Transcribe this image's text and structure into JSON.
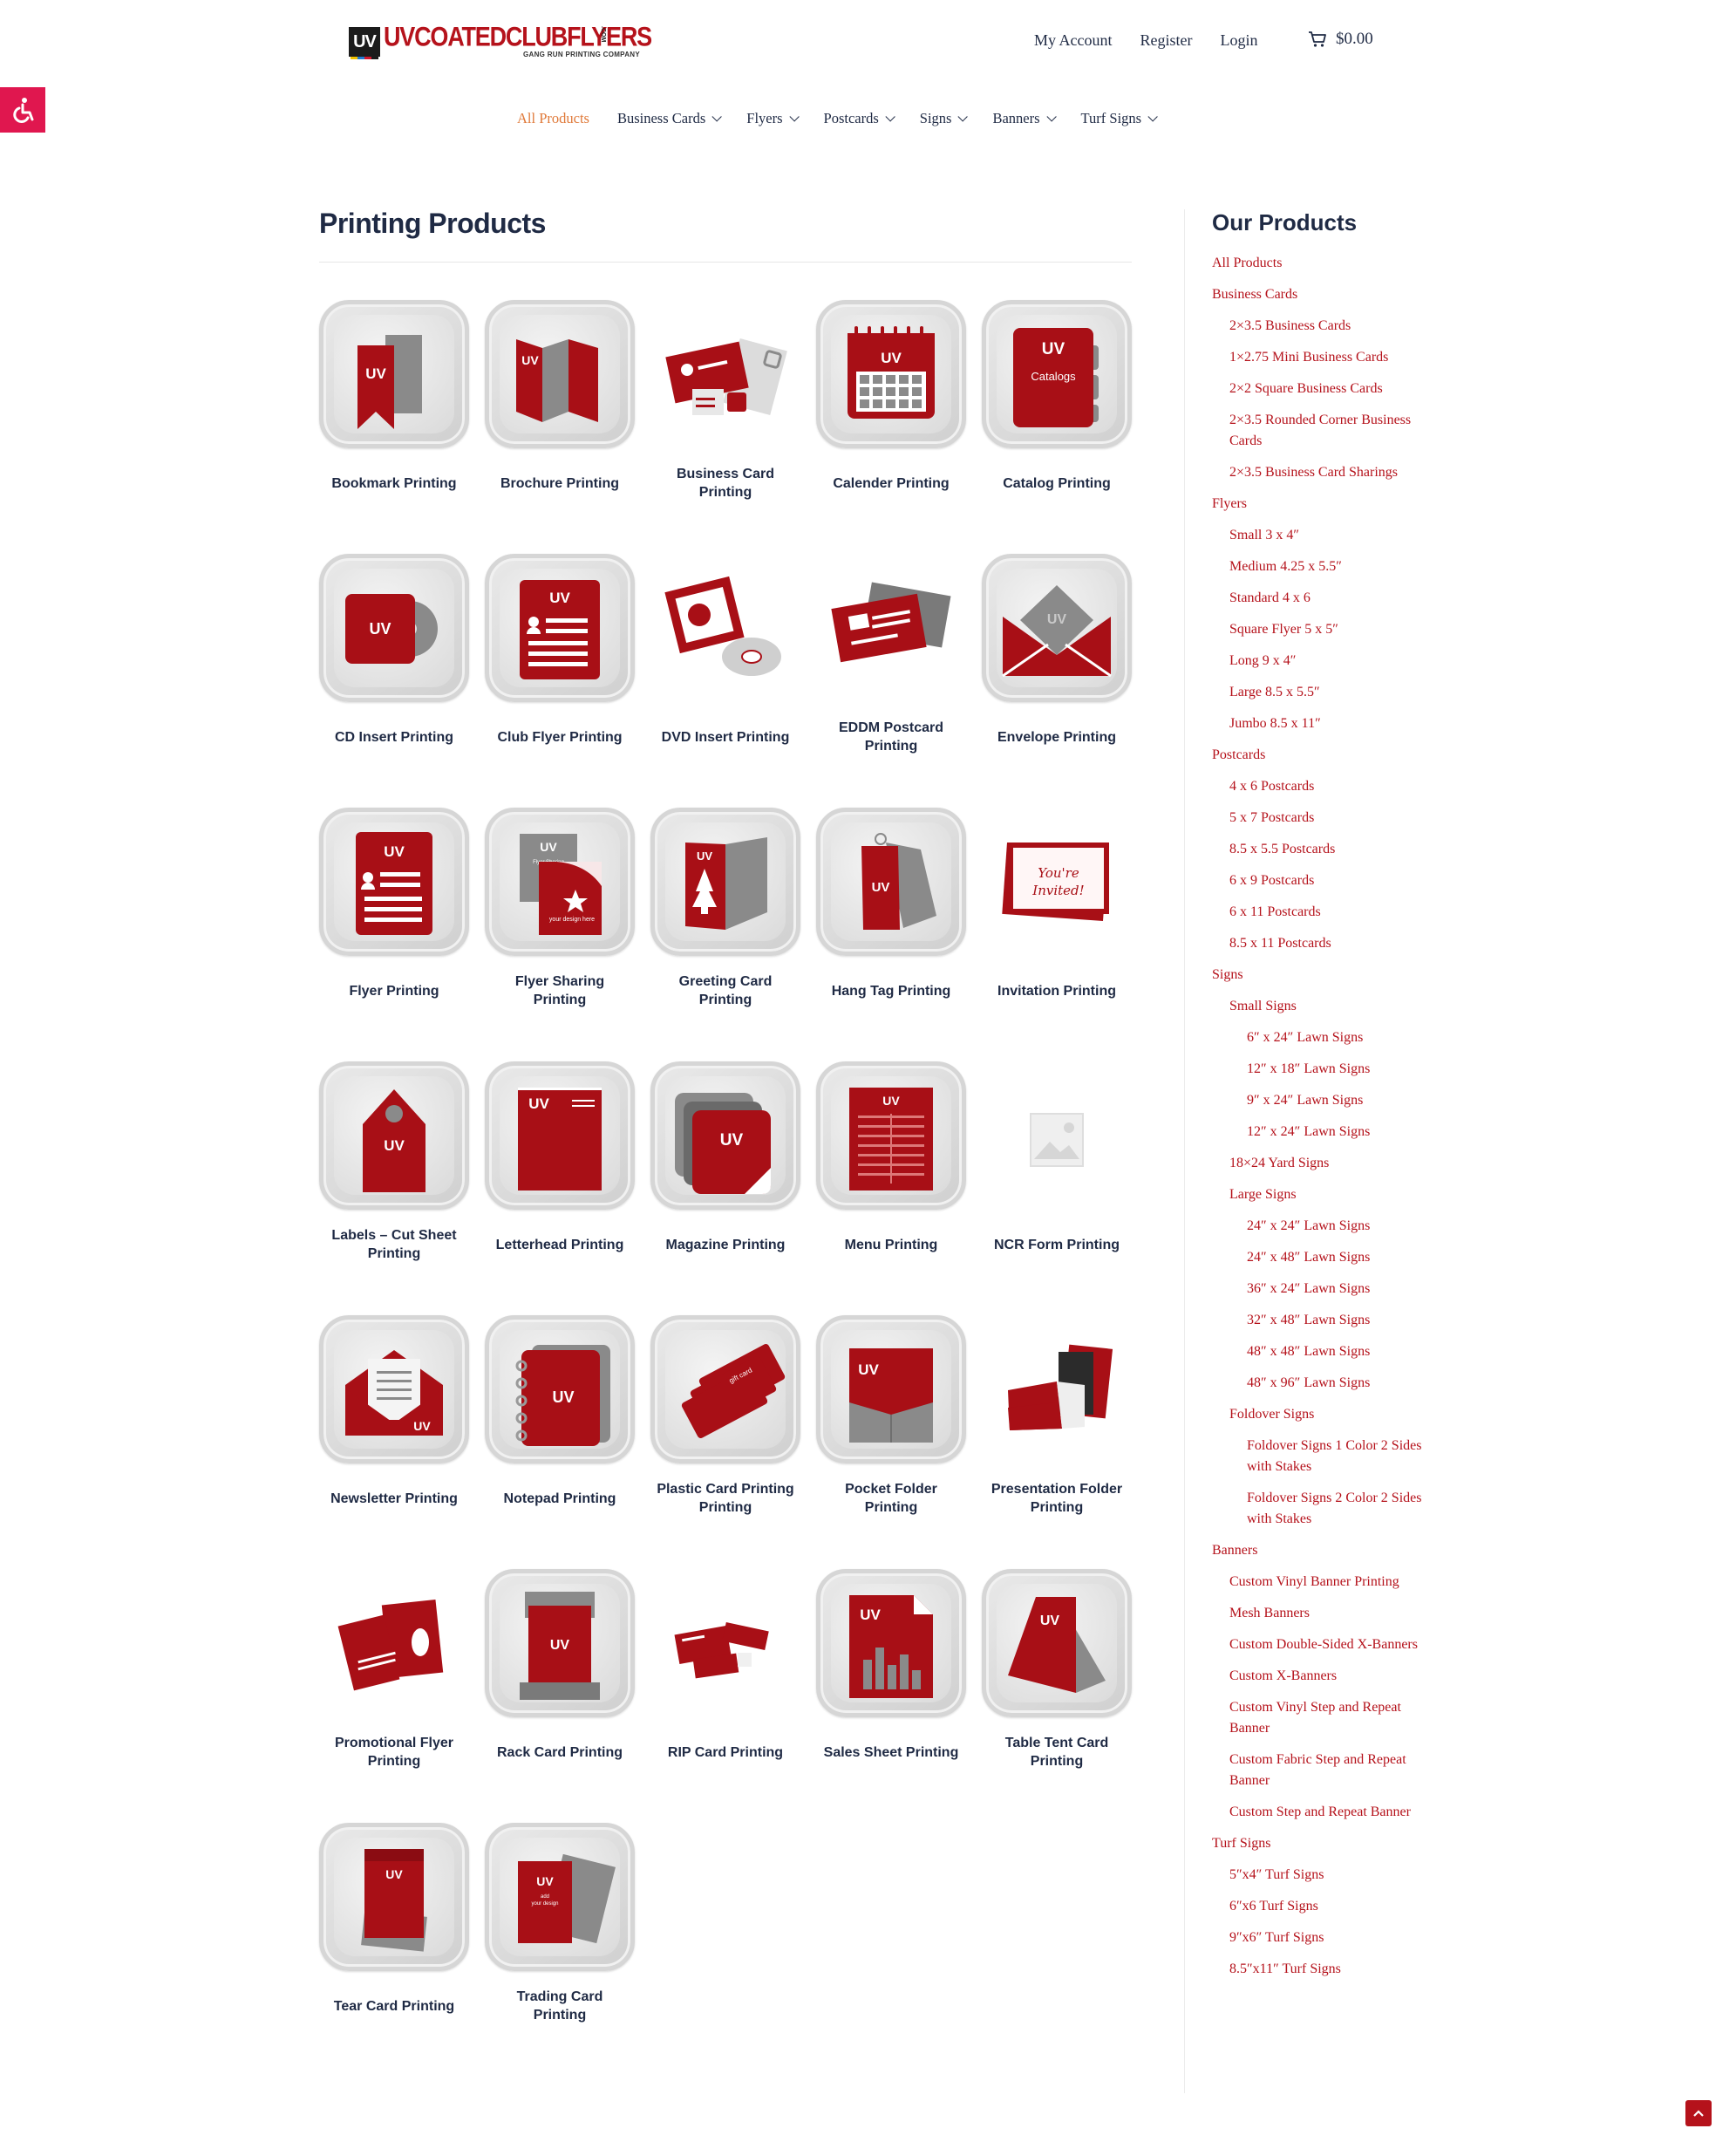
{
  "header": {
    "logo": {
      "mark": "UV",
      "name": "UVCOATEDCLUBFLYERS",
      "suffix": ".COM",
      "tagline": "GANG RUN PRINTING COMPANY"
    },
    "account_links": [
      "My Account",
      "Register",
      "Login"
    ],
    "cart_total": "$0.00"
  },
  "nav": [
    {
      "label": "All Products",
      "active": true,
      "dropdown": false
    },
    {
      "label": "Business Cards",
      "dropdown": true
    },
    {
      "label": "Flyers",
      "dropdown": true
    },
    {
      "label": "Postcards",
      "dropdown": true
    },
    {
      "label": "Signs",
      "dropdown": true
    },
    {
      "label": "Banners",
      "dropdown": true
    },
    {
      "label": "Turf Signs",
      "dropdown": true
    }
  ],
  "main": {
    "title": "Printing Products",
    "products": [
      {
        "label": "Bookmark Printing",
        "icon": "bookmark-icon",
        "tile": true
      },
      {
        "label": "Brochure Printing",
        "icon": "brochure-icon",
        "tile": true
      },
      {
        "label": "Business Card Printing",
        "icon": "business-card-icon",
        "tile": false
      },
      {
        "label": "Calender Printing",
        "icon": "calendar-icon",
        "tile": true
      },
      {
        "label": "Catalog Printing",
        "icon": "catalog-icon",
        "tile": true,
        "text": "Catalogs"
      },
      {
        "label": "CD Insert Printing",
        "icon": "cd-insert-icon",
        "tile": true
      },
      {
        "label": "Club Flyer Printing",
        "icon": "club-flyer-icon",
        "tile": true
      },
      {
        "label": "DVD Insert Printing",
        "icon": "dvd-insert-icon",
        "tile": false
      },
      {
        "label": "EDDM Postcard Printing",
        "icon": "eddm-postcard-icon",
        "tile": false
      },
      {
        "label": "Envelope Printing",
        "icon": "envelope-icon",
        "tile": true
      },
      {
        "label": "Flyer Printing",
        "icon": "flyer-icon",
        "tile": true
      },
      {
        "label": "Flyer Sharing Printing",
        "icon": "flyer-sharing-icon",
        "tile": true,
        "text": "Flyer Sharing",
        "text2": "your design here"
      },
      {
        "label": "Greeting Card Printing",
        "icon": "greeting-card-icon",
        "tile": true
      },
      {
        "label": "Hang Tag Printing",
        "icon": "hang-tag-icon",
        "tile": true
      },
      {
        "label": "Invitation Printing",
        "icon": "invitation-icon",
        "tile": false,
        "text": "You're Invited!"
      },
      {
        "label": "Labels – Cut Sheet Printing",
        "icon": "label-tag-icon",
        "tile": true
      },
      {
        "label": "Letterhead Printing",
        "icon": "letterhead-icon",
        "tile": true
      },
      {
        "label": "Magazine Printing",
        "icon": "magazine-icon",
        "tile": true
      },
      {
        "label": "Menu Printing",
        "icon": "menu-icon",
        "tile": true
      },
      {
        "label": "NCR Form Printing",
        "icon": "image-placeholder-icon",
        "tile": false
      },
      {
        "label": "Newsletter Printing",
        "icon": "newsletter-icon",
        "tile": true
      },
      {
        "label": "Notepad Printing",
        "icon": "notepad-icon",
        "tile": true
      },
      {
        "label": "Plastic Card Printing Printing",
        "icon": "plastic-card-icon",
        "tile": true
      },
      {
        "label": "Pocket Folder Printing",
        "icon": "pocket-folder-icon",
        "tile": true
      },
      {
        "label": "Presentation Folder Printing",
        "icon": "presentation-folder-icon",
        "tile": false
      },
      {
        "label": "Promotional Flyer Printing",
        "icon": "promotional-flyer-icon",
        "tile": false
      },
      {
        "label": "Rack Card Printing",
        "icon": "rack-card-icon",
        "tile": true
      },
      {
        "label": "RIP Card Printing",
        "icon": "rip-card-icon",
        "tile": false
      },
      {
        "label": "Sales Sheet Printing",
        "icon": "sales-sheet-icon",
        "tile": true
      },
      {
        "label": "Table Tent Card Printing",
        "icon": "table-tent-icon",
        "tile": true
      },
      {
        "label": "Tear Card Printing",
        "icon": "tear-card-icon",
        "tile": true
      },
      {
        "label": "Trading Card Printing",
        "icon": "trading-card-icon",
        "tile": true,
        "text": "add your design"
      }
    ]
  },
  "sidebar": {
    "title": "Our Products",
    "items": [
      {
        "label": "All Products",
        "level": 0
      },
      {
        "label": "Business Cards",
        "level": 0
      },
      {
        "label": "2×3.5 Business Cards",
        "level": 1
      },
      {
        "label": "1×2.75 Mini Business Cards",
        "level": 1
      },
      {
        "label": "2×2 Square Business Cards",
        "level": 1
      },
      {
        "label": "2×3.5 Rounded Corner Business Cards",
        "level": 1
      },
      {
        "label": "2×3.5 Business Card Sharings",
        "level": 1
      },
      {
        "label": "Flyers",
        "level": 0
      },
      {
        "label": "Small 3 x 4″",
        "level": 1
      },
      {
        "label": "Medium 4.25 x 5.5″",
        "level": 1
      },
      {
        "label": "Standard 4 x 6",
        "level": 1
      },
      {
        "label": "Square Flyer 5 x 5″",
        "level": 1
      },
      {
        "label": "Long 9 x 4″",
        "level": 1
      },
      {
        "label": "Large 8.5 x 5.5″",
        "level": 1
      },
      {
        "label": "Jumbo 8.5 x 11″",
        "level": 1
      },
      {
        "label": "Postcards",
        "level": 0
      },
      {
        "label": "4 x 6 Postcards",
        "level": 1
      },
      {
        "label": "5 x 7 Postcards",
        "level": 1
      },
      {
        "label": "8.5 x 5.5 Postcards",
        "level": 1
      },
      {
        "label": "6 x 9 Postcards",
        "level": 1
      },
      {
        "label": "6 x 11 Postcards",
        "level": 1
      },
      {
        "label": "8.5 x 11 Postcards",
        "level": 1
      },
      {
        "label": "Signs",
        "level": 0
      },
      {
        "label": "Small Signs",
        "level": 1
      },
      {
        "label": "6″ x 24″ Lawn Signs",
        "level": 2
      },
      {
        "label": "12″ x 18″ Lawn Signs",
        "level": 2
      },
      {
        "label": "9″ x 24″ Lawn Signs",
        "level": 2
      },
      {
        "label": "12″ x 24″ Lawn Signs",
        "level": 2
      },
      {
        "label": "18×24 Yard Signs",
        "level": 1
      },
      {
        "label": "Large Signs",
        "level": 1
      },
      {
        "label": "24″ x 24″ Lawn Signs",
        "level": 2
      },
      {
        "label": "24″ x 48″ Lawn Signs",
        "level": 2
      },
      {
        "label": "36″ x 24″ Lawn Signs",
        "level": 2
      },
      {
        "label": "32″ x 48″ Lawn Signs",
        "level": 2
      },
      {
        "label": "48″ x 48″ Lawn Signs",
        "level": 2
      },
      {
        "label": "48″ x 96″ Lawn Signs",
        "level": 2
      },
      {
        "label": "Foldover Signs",
        "level": 1
      },
      {
        "label": "Foldover Signs 1 Color 2 Sides with Stakes",
        "level": 2
      },
      {
        "label": "Foldover Signs 2 Color 2 Sides with Stakes",
        "level": 2
      },
      {
        "label": "Banners",
        "level": 0
      },
      {
        "label": "Custom Vinyl Banner Printing",
        "level": 1
      },
      {
        "label": "Mesh Banners",
        "level": 1
      },
      {
        "label": "Custom Double-Sided X-Banners",
        "level": 1
      },
      {
        "label": "Custom X-Banners",
        "level": 1
      },
      {
        "label": "Custom Vinyl Step and Repeat Banner",
        "level": 1
      },
      {
        "label": "Custom Fabric Step and Repeat Banner",
        "level": 1
      },
      {
        "label": "Custom Step and Repeat Banner",
        "level": 1
      },
      {
        "label": "Turf Signs",
        "level": 0
      },
      {
        "label": "5″x4″ Turf Signs",
        "level": 1
      },
      {
        "label": "6″x6 Turf Signs",
        "level": 1
      },
      {
        "label": "9″x6″ Turf Signs",
        "level": 1
      },
      {
        "label": "8.5″x11″ Turf Signs",
        "level": 1
      }
    ]
  },
  "colors": {
    "brand_red": "#b5121b",
    "accent_orange": "#e07a3a",
    "text_navy": "#1f2a44",
    "a11y_pink": "#e0174f"
  }
}
